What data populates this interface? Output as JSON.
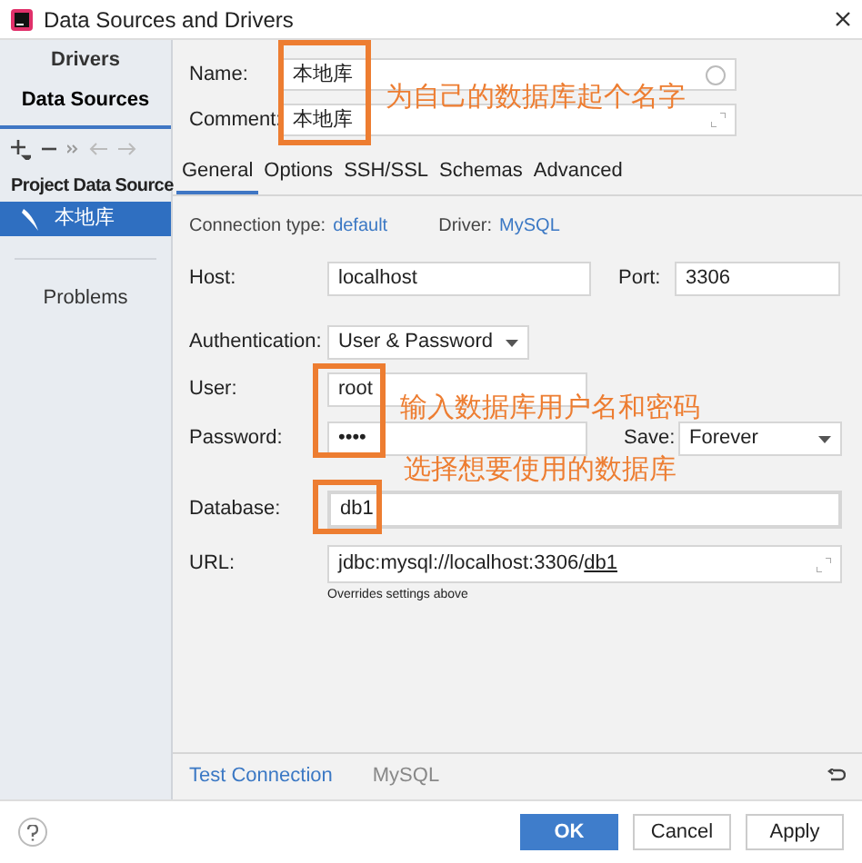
{
  "window": {
    "title": "Data Sources and Drivers"
  },
  "sidebar": {
    "tabs": [
      {
        "label": "Drivers",
        "selected": false
      },
      {
        "label": "Data Sources",
        "selected": true
      }
    ],
    "section": "Project Data Source",
    "items": [
      {
        "label": "本地库",
        "selected": true
      }
    ],
    "problems": "Problems"
  },
  "name": {
    "label": "Name:",
    "value": "本地库"
  },
  "comment": {
    "label": "Comment:",
    "value": "本地库"
  },
  "tabs": [
    {
      "label": "General",
      "selected": true
    },
    {
      "label": "Options",
      "selected": false
    },
    {
      "label": "SSH/SSL",
      "selected": false
    },
    {
      "label": "Schemas",
      "selected": false
    },
    {
      "label": "Advanced",
      "selected": false
    }
  ],
  "connection_type": {
    "label": "Connection type:",
    "value": "default"
  },
  "driver": {
    "label": "Driver:",
    "value": "MySQL"
  },
  "host": {
    "label": "Host:",
    "value": "localhost"
  },
  "port": {
    "label": "Port:",
    "value": "3306"
  },
  "authentication": {
    "label": "Authentication:",
    "value": "User & Password"
  },
  "user": {
    "label": "User:",
    "value": "root"
  },
  "password": {
    "label": "Password:",
    "value": "••••"
  },
  "save": {
    "label": "Save:",
    "value": "Forever"
  },
  "database": {
    "label": "Database:",
    "value": "db1"
  },
  "url": {
    "label": "URL:",
    "value": "jdbc:mysql://localhost:3306/",
    "database": "db1",
    "note": "Overrides settings above"
  },
  "bottom_bar": {
    "test_connection": "Test Connection",
    "driver": "MySQL"
  },
  "buttons": [
    {
      "label": "OK",
      "kind": "primary"
    },
    {
      "label": "Cancel",
      "kind": "default"
    },
    {
      "label": "Apply",
      "kind": "default"
    }
  ],
  "annotations": [
    {
      "text": "为自己的数据库起个名字"
    },
    {
      "text": "输入数据库用户名和密码"
    },
    {
      "text": "选择想要使用的数据库"
    }
  ]
}
